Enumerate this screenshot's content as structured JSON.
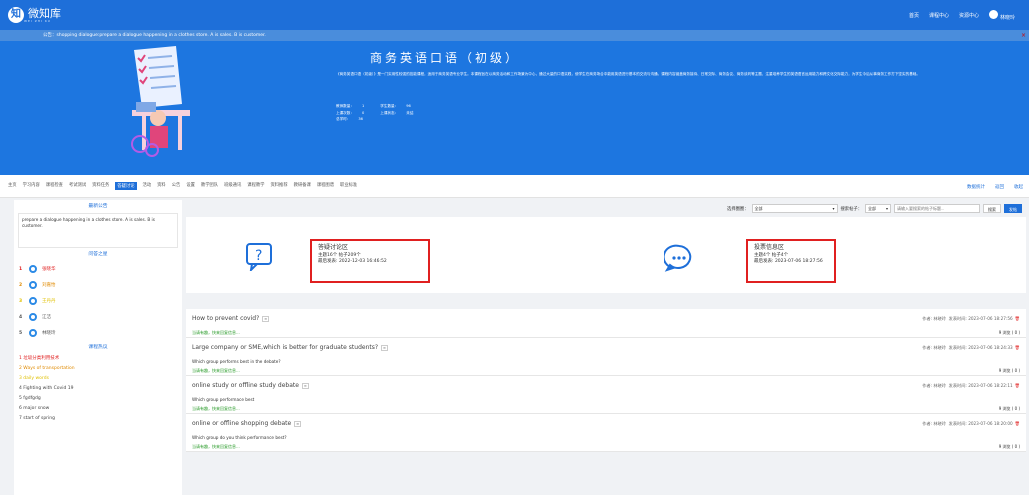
{
  "header": {
    "logo_text": "微知库",
    "logo_sub": "WEI ZHI KU",
    "nav": [
      "首页",
      "课程中心",
      "资源中心"
    ],
    "user_name": "林晓玲"
  },
  "announcement": "公告：shopping dialogue:prepare a dialogue happening in a clothes store. A is sales. B is customer.",
  "course": {
    "title": "商务英语口语（初级）",
    "description": "《商务英语口语（初级）》是一门实用性较强的技能课程，适用于商务英语专业学生。本课程旨在以商务活动和工作场景为中心，通过大量的口语实践，使学生在商务场合中能用英语进行基本的交流与沟通。课程内容涵盖商务接待、日常交际、商务会议、商务谈判等主题，注重培养学生的英语语言运用能力和跨文化交际能力，为学生今后从事商务工作打下坚实的基础。",
    "meta": {
      "teachers_label": "教师数量：",
      "teachers_value": "1",
      "students_label": "学生数量：",
      "students_value": "96",
      "uploads_label": "上课次数：",
      "uploads_value": "0",
      "status_label": "上课状态：",
      "status_value": "未结",
      "total_label": "总学时：",
      "total_value": "36"
    }
  },
  "toolbar": {
    "tabs": [
      "主页",
      "学习内容",
      "课程检查",
      "考试测试",
      "资料任务",
      "答疑讨论",
      "活动",
      "资料",
      "公告",
      "设置",
      "教学团队",
      "班级通讯",
      "课程教学",
      "资料推荐",
      "教研备课",
      "课程图谱",
      "职业标准"
    ],
    "active_tab": "答疑讨论",
    "right": [
      "数据统计",
      "返回",
      "收起"
    ]
  },
  "sidebar": {
    "notice_heading": "最新公告",
    "notice_text": "prepare a dialogue happening in a clothes store. A is sales. B is customer.",
    "ranking_heading": "问答之星",
    "ranking": [
      {
        "num": "1",
        "name": "张晓华",
        "color": "#e02020"
      },
      {
        "num": "2",
        "name": "刘嘉怡",
        "color": "#e08a00"
      },
      {
        "num": "3",
        "name": "王丹丹",
        "color": "#e0c000"
      },
      {
        "num": "4",
        "name": "江洁",
        "color": "#555555"
      },
      {
        "num": "5",
        "name": "林晓玲",
        "color": "#555555"
      }
    ],
    "recommend_heading": "课程热议",
    "recommend": [
      {
        "text": "1 垃圾分类利用技术",
        "color": "#e02020"
      },
      {
        "text": "2 Ways of transportation",
        "color": "#e08a00"
      },
      {
        "text": "3 daily words",
        "color": "#e0c000"
      },
      {
        "text": "4 Fighting with Covid 19",
        "color": "#444444"
      },
      {
        "text": "5 fgdfgdg",
        "color": "#444444"
      },
      {
        "text": "6 major snow",
        "color": "#444444"
      },
      {
        "text": "7 start of spring",
        "color": "#444444"
      }
    ]
  },
  "filter": {
    "category_label": "选择圈圈：",
    "category_value": "全部",
    "scope_label": "搜索帖子：",
    "scope_value": "全部",
    "search_placeholder": "请输入要搜索的帖子标题...",
    "search_button": "搜索",
    "post_button": "发帖"
  },
  "zones": [
    {
      "title": "答疑讨论区",
      "stats": "主题16个 帖子209个",
      "last": "最后发表: 2022-12-03 16:46:52"
    },
    {
      "title": "投票信息区",
      "stats": "主题4个 帖子4个",
      "last": "最后发表: 2023-07-06 18:27:56"
    }
  ],
  "posts": [
    {
      "title": "How to prevent covid?",
      "body": "",
      "author_label": "作者:",
      "author": "林晓玲",
      "time_label": "发表时间:",
      "time": "2023-07-06 18:27:56",
      "reply_prompt": "当请有趣，快来回复信息...",
      "replies": "9 浏览 ( 0 )"
    },
    {
      "title": "Large company or SME,which is better for graduate students?",
      "body": "Which group performs best in the debate?",
      "author_label": "作者:",
      "author": "林晓玲",
      "time_label": "发表时间:",
      "time": "2023-07-06 18:24:33",
      "reply_prompt": "当请有趣，快来回复信息...",
      "replies": "9 浏览 ( 0 )"
    },
    {
      "title": "online study or offline study debate",
      "body": "Which group performace best",
      "author_label": "作者:",
      "author": "林晓玲",
      "time_label": "发表时间:",
      "time": "2023-07-06 18:22:11",
      "reply_prompt": "当请有趣，快来回复信息...",
      "replies": "9 浏览 ( 0 )"
    },
    {
      "title": "online or offline shopping debate",
      "body": "Which group do you think performance best?",
      "author_label": "作者:",
      "author": "林晓玲",
      "time_label": "发表时间:",
      "time": "2023-07-06 18:20:00",
      "reply_prompt": "当请有趣，快来回复信息...",
      "replies": "9 浏览 ( 0 )"
    }
  ]
}
